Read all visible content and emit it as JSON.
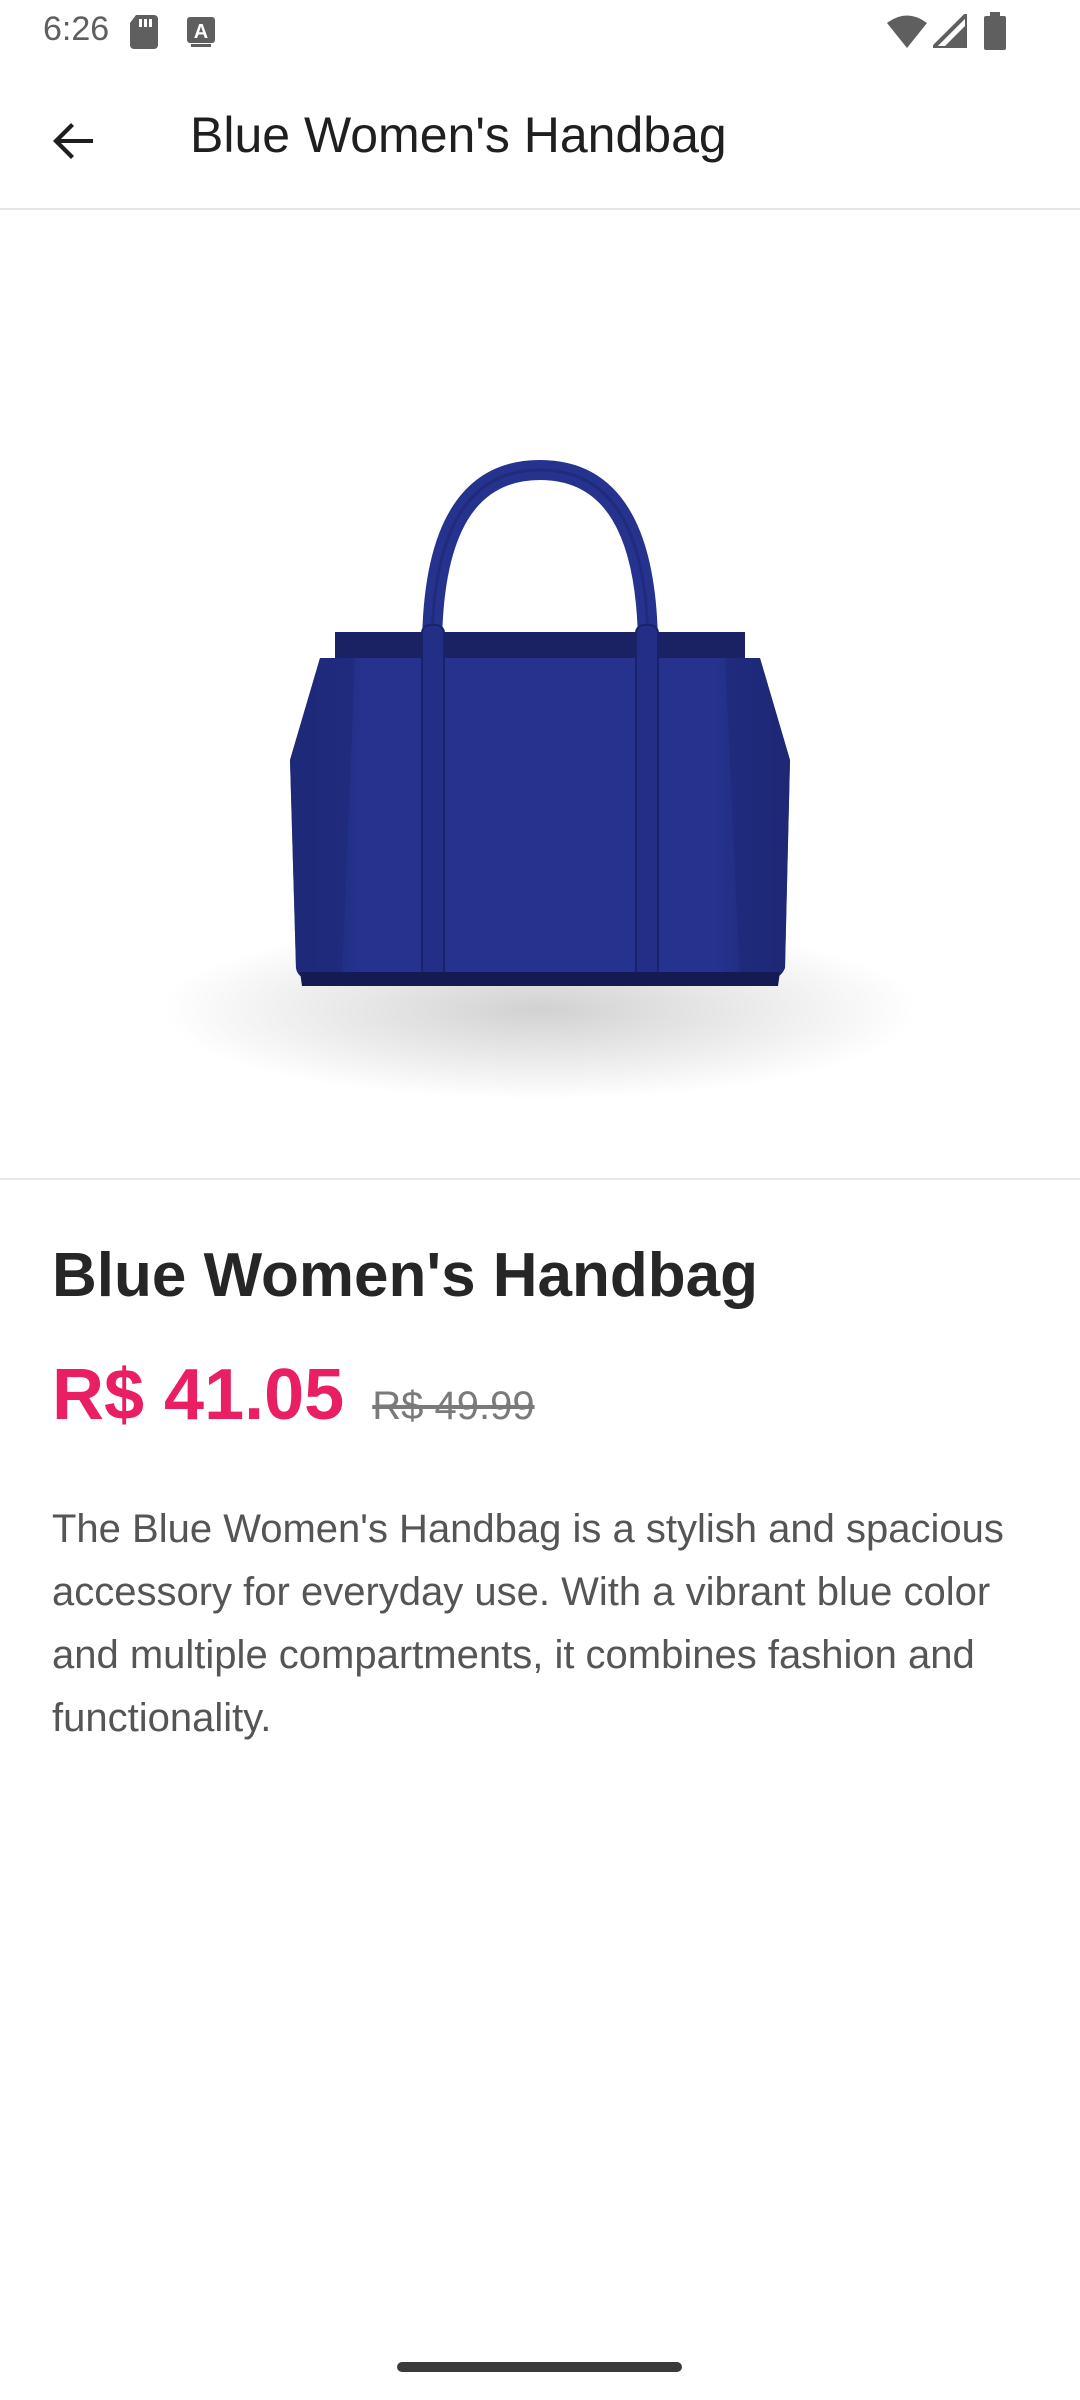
{
  "status_bar": {
    "time": "6:26",
    "icons": [
      "sd-card-icon",
      "a-keyboard-icon",
      "wifi-icon",
      "signal-icon",
      "battery-icon"
    ]
  },
  "app_bar": {
    "title": "Blue Women's Handbag",
    "back_icon": "arrow-back-icon"
  },
  "product": {
    "name": "Blue Women's Handbag",
    "price": "R$ 41.05",
    "original_price": "R$ 49.99",
    "description": "The Blue Women's Handbag is a stylish and spacious accessory for everyday use. With a vibrant blue color and multiple compartments, it combines fashion and functionality.",
    "image_alt": "Blue Women's Handbag product image"
  },
  "colors": {
    "accent": "#e91e63",
    "bag": "#233189"
  }
}
